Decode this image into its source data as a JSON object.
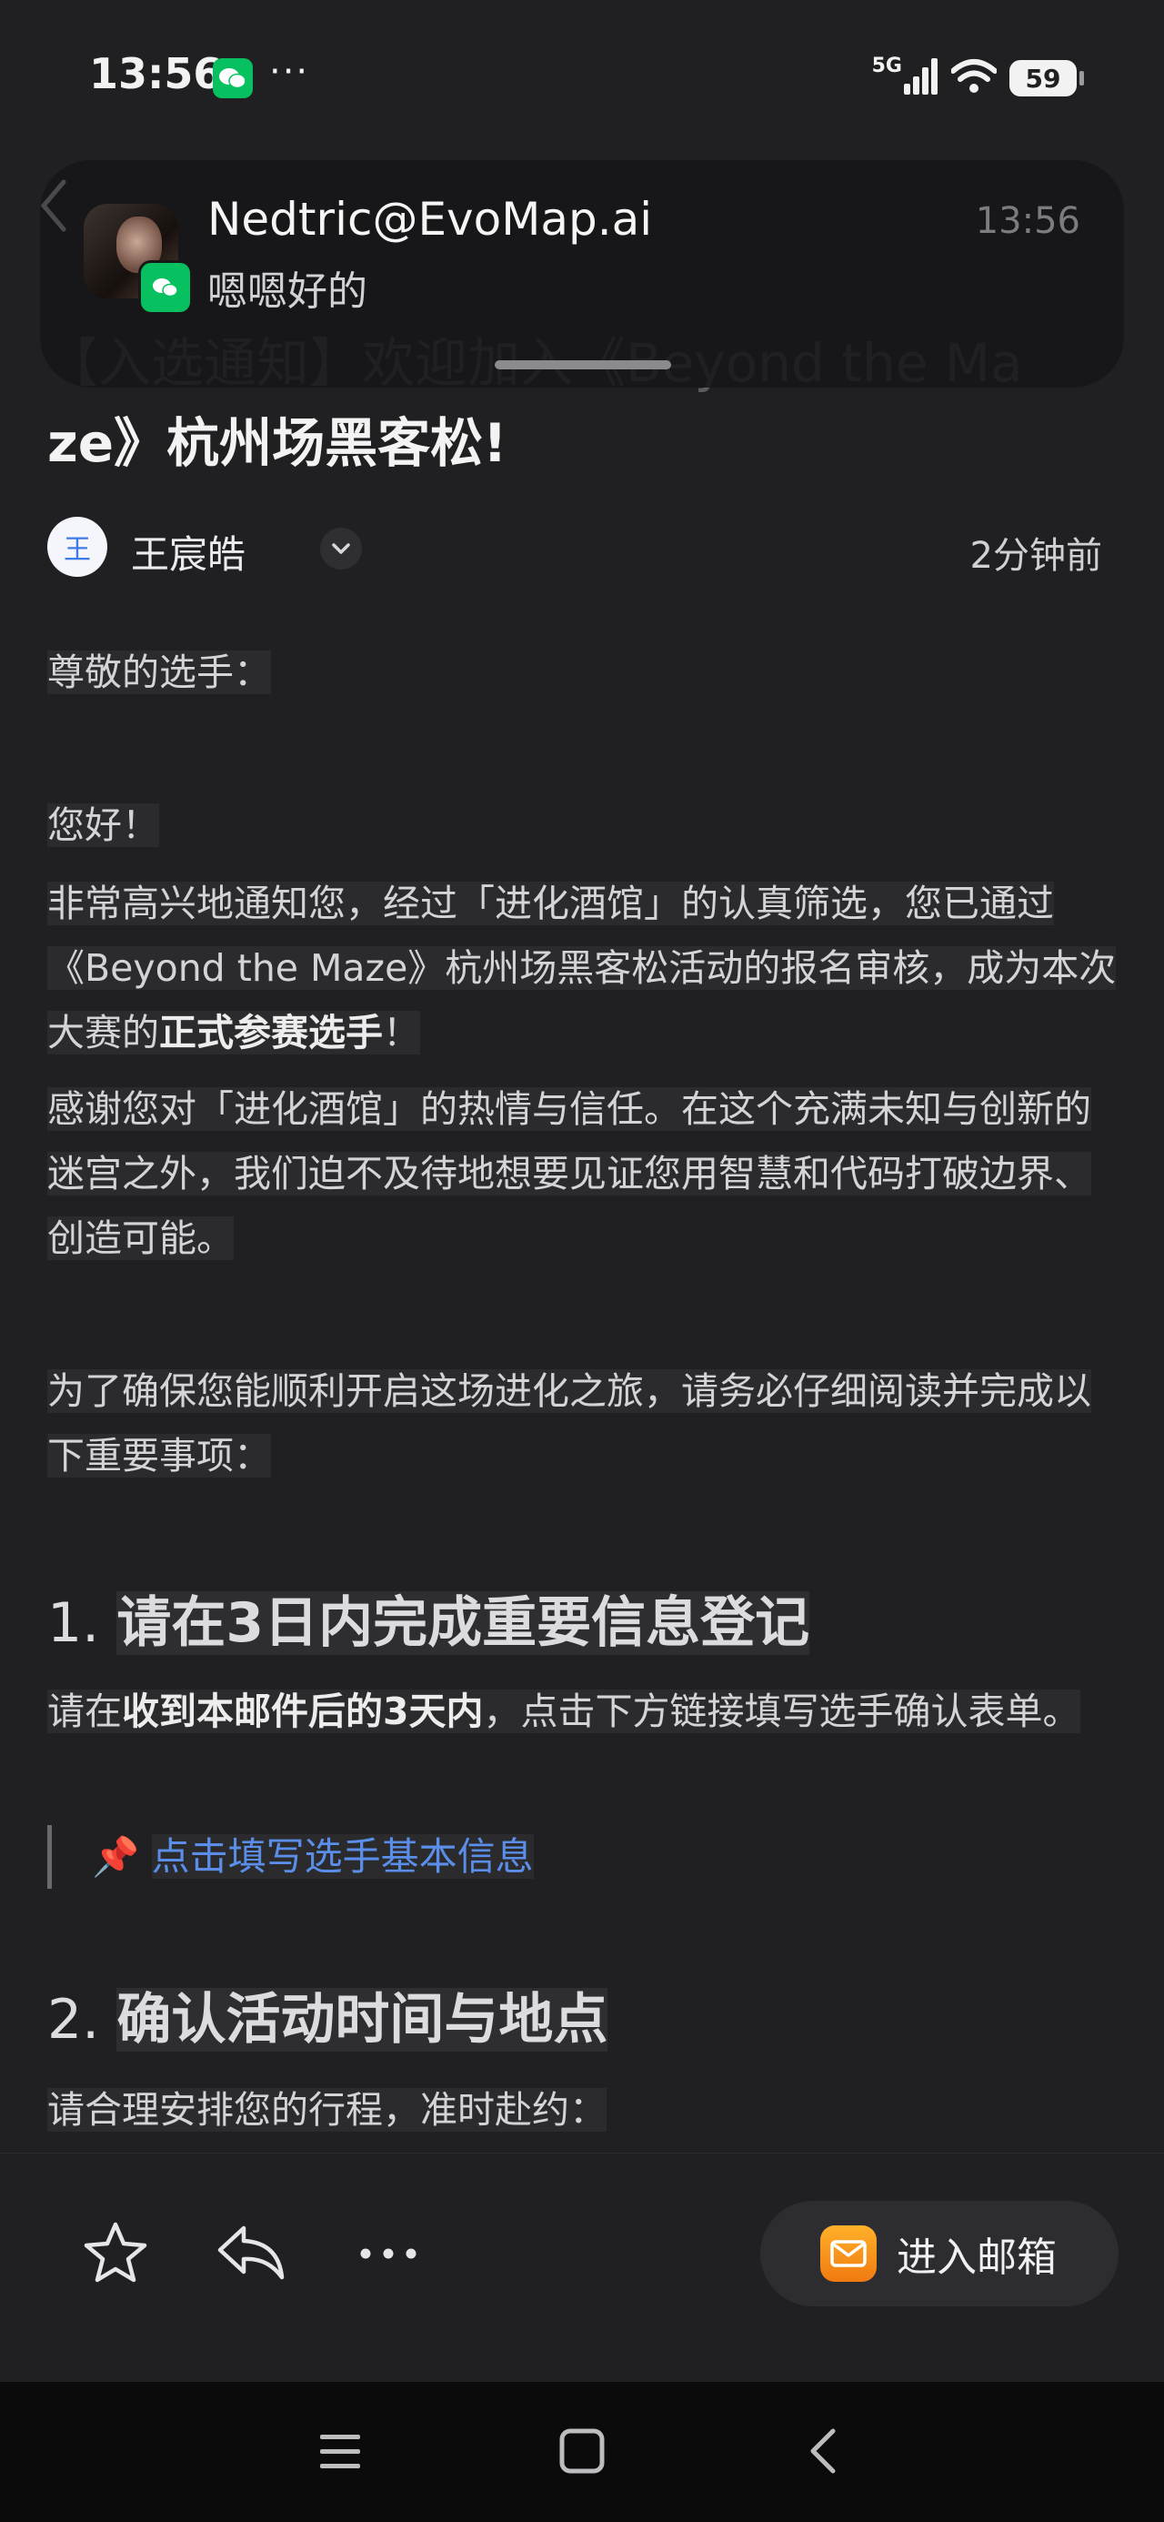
{
  "status_bar": {
    "time": "13:56",
    "more": "···",
    "network": "5G",
    "battery": "59",
    "icons": [
      "wechat-icon",
      "signal-icon",
      "wifi-icon",
      "battery-icon"
    ]
  },
  "notification": {
    "title": "Nedtric@EvoMap.ai",
    "message": "嗯嗯好的",
    "time": "13:56",
    "app_icon": "wechat-icon"
  },
  "email": {
    "subject_line1": "【入选通知】欢迎加入《Beyond the Ma",
    "subject_line2": "ze》杭州场黑客松!",
    "sender": {
      "avatar_letter": "王",
      "name": "王宸皓",
      "time": "2分钟前"
    },
    "greeting": "尊敬的选手：",
    "hello": "您好！",
    "para1_a": "非常高兴地通知您，经过「进化酒馆」的认真筛选，您已通过《Beyond the Maze》杭州场黑客松活动的报名审核，成为本次大赛的",
    "para1_bold": "正式参赛选手",
    "para1_end": "！",
    "para2": "感谢您对「进化酒馆」的热情与信任。在这个充满未知与创新的迷宫之外，我们迫不及待地想要见证您用智慧和代码打破边界、创造可能。",
    "para3": "为了确保您能顺利开启这场进化之旅，请务必仔细阅读并完成以下重要事项：",
    "section1": {
      "number": "1.",
      "title": "请在3日内完成重要信息登记",
      "text_a": "请在",
      "text_bold": "收到本邮件后的3天内",
      "text_b": "，点击下方链接填写选手确认表单。",
      "link_pin": "📌",
      "link_text": "点击填写选手基本信息"
    },
    "section2": {
      "number": "2.",
      "title": "确认活动时间与地点",
      "text": "请合理安排您的行程，准时赴约："
    }
  },
  "actions": {
    "enter_mailbox": "进入邮箱",
    "icons": [
      "star-icon",
      "reply-icon",
      "more-icon",
      "mailbox-icon"
    ]
  },
  "nav": {
    "icons": [
      "menu-icon",
      "home-icon",
      "back-icon"
    ]
  }
}
